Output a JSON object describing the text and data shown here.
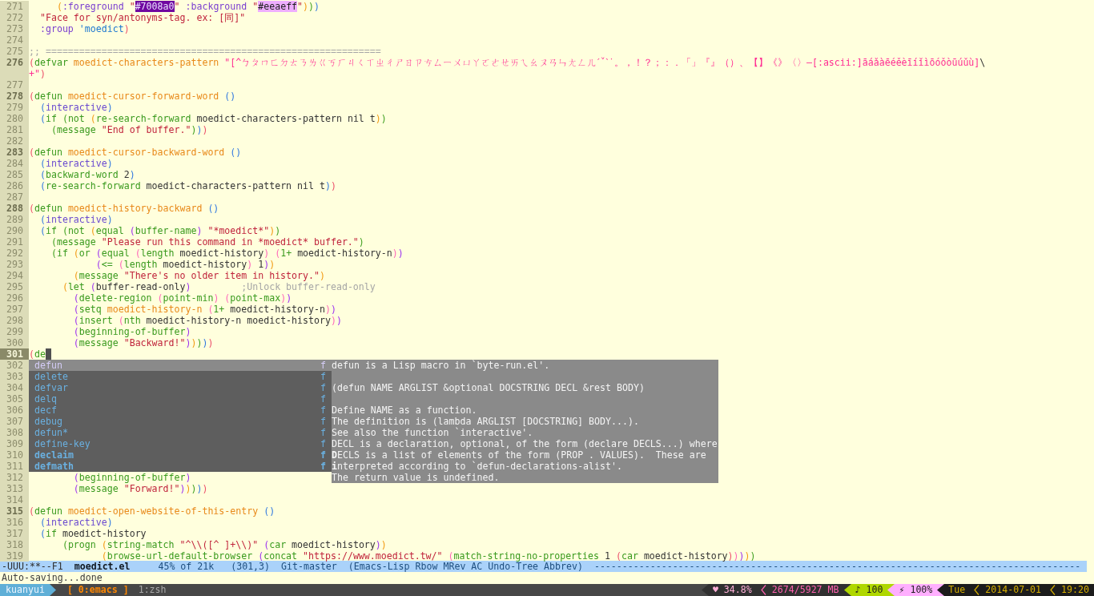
{
  "editor": {
    "lines": [
      {
        "number": "271",
        "bold": false,
        "selected": false,
        "tokens": [
          {
            "text": "     (",
            "kind": "paren4"
          },
          {
            "text": ":foreground",
            "kind": "const"
          },
          {
            "text": " \"",
            "kind": "string"
          },
          {
            "text": "#7008a0",
            "kind": "swatch",
            "color": "#7008a0"
          },
          {
            "text": "\" ",
            "kind": "string"
          },
          {
            "text": ":background",
            "kind": "const"
          },
          {
            "text": " \"",
            "kind": "string"
          },
          {
            "text": "#eeaeff",
            "kind": "swatch",
            "color": "#eeaeff"
          },
          {
            "text": "\"",
            "kind": "string"
          },
          {
            "text": ")",
            "kind": "paren4"
          },
          {
            "text": ")",
            "kind": "paren3"
          },
          {
            "text": ")",
            "kind": "paren2"
          }
        ]
      },
      {
        "number": "272",
        "bold": false,
        "selected": false,
        "tokens": [
          {
            "text": "  \"Face for syn/antonyms-tag. ex: [同]\"",
            "kind": "string"
          }
        ]
      },
      {
        "number": "273",
        "bold": false,
        "selected": false,
        "tokens": [
          {
            "text": "  :group ",
            "kind": "const"
          },
          {
            "text": "'moedict",
            "kind": "quote"
          },
          {
            "text": ")",
            "kind": "paren1"
          }
        ]
      },
      {
        "number": "274",
        "bold": false,
        "selected": false
      },
      {
        "number": "275",
        "bold": false,
        "selected": false,
        "tokens": [
          {
            "text": ";; ============================================================",
            "kind": "comment"
          }
        ]
      },
      {
        "number": "276",
        "bold": true,
        "selected": false,
        "tokens": [
          {
            "text": "(",
            "kind": "paren1"
          },
          {
            "text": "defvar ",
            "kind": "builtin"
          },
          {
            "text": "moedict-characters-pattern ",
            "kind": "name"
          },
          {
            "text": "\"[^ㄅㄆㄇㄈㄉㄊㄋㄌㄍㄎㄏㄐㄑㄒㄓㄔㄕㄖㄗㄘㄙㄧㄨㄩㄚㄛㄜㄝㄞㄟㄠㄡㄢㄣㄤㄥㄦˊˇˋ˙。，！？；：．「」『』（）、【】《》〈〉—[:ascii:]āáǎàēéěèīíǐìōóǒòūúǔù]",
            "kind": "pattern"
          },
          {
            "text": "\\",
            "kind": "wrap"
          }
        ]
      },
      {
        "tokens": [
          {
            "text": "+\"",
            "kind": "pattern"
          },
          {
            "text": ")",
            "kind": "paren1"
          }
        ]
      },
      {
        "number": "277",
        "bold": false,
        "selected": false
      },
      {
        "number": "278",
        "bold": true,
        "selected": false,
        "tokens": [
          {
            "text": "(",
            "kind": "paren1"
          },
          {
            "text": "defun ",
            "kind": "builtin"
          },
          {
            "text": "moedict-cursor-forward-word ",
            "kind": "name"
          },
          {
            "text": "()",
            "kind": "paren2"
          }
        ]
      },
      {
        "number": "279",
        "bold": false,
        "selected": false,
        "tokens": [
          {
            "text": "  (",
            "kind": "paren2"
          },
          {
            "text": "interactive",
            "kind": "special"
          },
          {
            "text": ")",
            "kind": "paren2"
          }
        ]
      },
      {
        "number": "280",
        "bold": false,
        "selected": false,
        "tokens": [
          {
            "text": "  (",
            "kind": "paren2"
          },
          {
            "text": "if ",
            "kind": "builtin"
          },
          {
            "text": "(",
            "kind": "paren3"
          },
          {
            "text": "not ",
            "kind": "builtin"
          },
          {
            "text": "(",
            "kind": "paren4"
          },
          {
            "text": "re-search-forward",
            "kind": "builtin"
          },
          {
            "text": " moedict-characters-pattern nil t",
            "kind": "plain"
          },
          {
            "text": ")",
            "kind": "paren4"
          },
          {
            "text": ")",
            "kind": "paren3"
          }
        ]
      },
      {
        "number": "281",
        "bold": false,
        "selected": false,
        "tokens": [
          {
            "text": "    (",
            "kind": "paren3"
          },
          {
            "text": "message ",
            "kind": "builtin"
          },
          {
            "text": "\"End of buffer.\"",
            "kind": "string"
          },
          {
            "text": ")",
            "kind": "paren3"
          },
          {
            "text": ")",
            "kind": "paren2"
          },
          {
            "text": ")",
            "kind": "paren1"
          }
        ]
      },
      {
        "number": "282",
        "bold": false,
        "selected": false
      },
      {
        "number": "283",
        "bold": true,
        "selected": false,
        "tokens": [
          {
            "text": "(",
            "kind": "paren1"
          },
          {
            "text": "defun ",
            "kind": "builtin"
          },
          {
            "text": "moedict-cursor-backward-word ",
            "kind": "name"
          },
          {
            "text": "()",
            "kind": "paren2"
          }
        ]
      },
      {
        "number": "284",
        "bold": false,
        "selected": false,
        "tokens": [
          {
            "text": "  (",
            "kind": "paren2"
          },
          {
            "text": "interactive",
            "kind": "special"
          },
          {
            "text": ")",
            "kind": "paren2"
          }
        ]
      },
      {
        "number": "285",
        "bold": false,
        "selected": false,
        "tokens": [
          {
            "text": "  (",
            "kind": "paren2"
          },
          {
            "text": "backward-word",
            "kind": "builtin"
          },
          {
            "text": " 2",
            "kind": "plain"
          },
          {
            "text": ")",
            "kind": "paren2"
          }
        ]
      },
      {
        "number": "286",
        "bold": false,
        "selected": false,
        "tokens": [
          {
            "text": "  (",
            "kind": "paren2"
          },
          {
            "text": "re-search-forward",
            "kind": "builtin"
          },
          {
            "text": " moedict-characters-pattern nil t",
            "kind": "plain"
          },
          {
            "text": ")",
            "kind": "paren2"
          },
          {
            "text": ")",
            "kind": "paren1"
          }
        ]
      },
      {
        "number": "287",
        "bold": false,
        "selected": false
      },
      {
        "number": "288",
        "bold": true,
        "selected": false,
        "tokens": [
          {
            "text": "(",
            "kind": "paren1"
          },
          {
            "text": "defun ",
            "kind": "builtin"
          },
          {
            "text": "moedict-history-backward ",
            "kind": "name"
          },
          {
            "text": "()",
            "kind": "paren2"
          }
        ]
      },
      {
        "number": "289",
        "bold": false,
        "selected": false,
        "tokens": [
          {
            "text": "  (",
            "kind": "paren2"
          },
          {
            "text": "interactive",
            "kind": "special"
          },
          {
            "text": ")",
            "kind": "paren2"
          }
        ]
      },
      {
        "number": "290",
        "bold": false,
        "selected": false,
        "tokens": [
          {
            "text": "  (",
            "kind": "paren2"
          },
          {
            "text": "if ",
            "kind": "builtin"
          },
          {
            "text": "(",
            "kind": "paren3"
          },
          {
            "text": "not ",
            "kind": "builtin"
          },
          {
            "text": "(",
            "kind": "paren4"
          },
          {
            "text": "equal ",
            "kind": "builtin"
          },
          {
            "text": "(",
            "kind": "paren5"
          },
          {
            "text": "buffer-name",
            "kind": "builtin"
          },
          {
            "text": ") ",
            "kind": "paren5"
          },
          {
            "text": "\"*moedict*\"",
            "kind": "string"
          },
          {
            "text": ")",
            "kind": "paren4"
          },
          {
            "text": ")",
            "kind": "paren3"
          }
        ]
      },
      {
        "number": "291",
        "bold": false,
        "selected": false,
        "tokens": [
          {
            "text": "    (",
            "kind": "paren3"
          },
          {
            "text": "message ",
            "kind": "builtin"
          },
          {
            "text": "\"Please run this command in *moedict* buffer.\"",
            "kind": "string"
          },
          {
            "text": ")",
            "kind": "paren3"
          }
        ]
      },
      {
        "number": "292",
        "bold": false,
        "selected": false,
        "tokens": [
          {
            "text": "    (",
            "kind": "paren3"
          },
          {
            "text": "if ",
            "kind": "builtin"
          },
          {
            "text": "(",
            "kind": "paren4"
          },
          {
            "text": "or ",
            "kind": "builtin"
          },
          {
            "text": "(",
            "kind": "paren5"
          },
          {
            "text": "equal ",
            "kind": "builtin"
          },
          {
            "text": "(",
            "kind": "paren6"
          },
          {
            "text": "length",
            "kind": "builtin"
          },
          {
            "text": " moedict-history",
            "kind": "plain"
          },
          {
            "text": ") (",
            "kind": "paren6"
          },
          {
            "text": "1+",
            "kind": "builtin"
          },
          {
            "text": " moedict-history-n",
            "kind": "plain"
          },
          {
            "text": ")",
            "kind": "paren6"
          },
          {
            "text": ")",
            "kind": "paren5"
          }
        ]
      },
      {
        "number": "293",
        "bold": false,
        "selected": false,
        "tokens": [
          {
            "text": "            (",
            "kind": "paren5"
          },
          {
            "text": "<= ",
            "kind": "builtin"
          },
          {
            "text": "(",
            "kind": "paren6"
          },
          {
            "text": "length",
            "kind": "builtin"
          },
          {
            "text": " moedict-history",
            "kind": "plain"
          },
          {
            "text": ")",
            "kind": "paren6"
          },
          {
            "text": " 1",
            "kind": "plain"
          },
          {
            "text": ")",
            "kind": "paren5"
          },
          {
            "text": ")",
            "kind": "paren4"
          }
        ]
      },
      {
        "number": "294",
        "bold": false,
        "selected": false,
        "tokens": [
          {
            "text": "        (",
            "kind": "paren4"
          },
          {
            "text": "message ",
            "kind": "builtin"
          },
          {
            "text": "\"There's no older item in history.\"",
            "kind": "string"
          },
          {
            "text": ")",
            "kind": "paren4"
          }
        ]
      },
      {
        "number": "295",
        "bold": false,
        "selected": false,
        "tokens": [
          {
            "text": "      (",
            "kind": "paren4"
          },
          {
            "text": "let ",
            "kind": "builtin"
          },
          {
            "text": "(",
            "kind": "paren5"
          },
          {
            "text": "buffer-read-only",
            "kind": "plain"
          },
          {
            "text": ")",
            "kind": "paren5"
          },
          {
            "text": "         ;Unlock buffer-read-only",
            "kind": "comment"
          }
        ]
      },
      {
        "number": "296",
        "bold": false,
        "selected": false,
        "tokens": [
          {
            "text": "        (",
            "kind": "paren5"
          },
          {
            "text": "delete-region ",
            "kind": "builtin"
          },
          {
            "text": "(",
            "kind": "paren6"
          },
          {
            "text": "point-min",
            "kind": "builtin"
          },
          {
            "text": ") (",
            "kind": "paren6"
          },
          {
            "text": "point-max",
            "kind": "builtin"
          },
          {
            "text": ")",
            "kind": "paren6"
          },
          {
            "text": ")",
            "kind": "paren5"
          }
        ]
      },
      {
        "number": "297",
        "bold": false,
        "selected": false,
        "tokens": [
          {
            "text": "        (",
            "kind": "paren5"
          },
          {
            "text": "setq ",
            "kind": "builtin"
          },
          {
            "text": "moedict-history-n ",
            "kind": "name"
          },
          {
            "text": "(",
            "kind": "paren6"
          },
          {
            "text": "1+",
            "kind": "builtin"
          },
          {
            "text": " moedict-history-n",
            "kind": "plain"
          },
          {
            "text": ")",
            "kind": "paren6"
          },
          {
            "text": ")",
            "kind": "paren5"
          }
        ]
      },
      {
        "number": "298",
        "bold": false,
        "selected": false,
        "tokens": [
          {
            "text": "        (",
            "kind": "paren5"
          },
          {
            "text": "insert ",
            "kind": "builtin"
          },
          {
            "text": "(",
            "kind": "paren6"
          },
          {
            "text": "nth",
            "kind": "builtin"
          },
          {
            "text": " moedict-history-n moedict-history",
            "kind": "plain"
          },
          {
            "text": ")",
            "kind": "paren6"
          },
          {
            "text": ")",
            "kind": "paren5"
          }
        ]
      },
      {
        "number": "299",
        "bold": false,
        "selected": false,
        "tokens": [
          {
            "text": "        (",
            "kind": "paren5"
          },
          {
            "text": "beginning-of-buffer",
            "kind": "builtin"
          },
          {
            "text": ")",
            "kind": "paren5"
          }
        ]
      },
      {
        "number": "300",
        "bold": false,
        "selected": false,
        "tokens": [
          {
            "text": "        (",
            "kind": "paren5"
          },
          {
            "text": "message ",
            "kind": "builtin"
          },
          {
            "text": "\"Backward!\"",
            "kind": "string"
          },
          {
            "text": ")",
            "kind": "paren5"
          },
          {
            "text": ")",
            "kind": "paren4"
          },
          {
            "text": ")",
            "kind": "paren3"
          },
          {
            "text": ")",
            "kind": "paren2"
          },
          {
            "text": ")",
            "kind": "paren1"
          }
        ]
      },
      {
        "number": "301",
        "bold": true,
        "selected": true,
        "cursor": true,
        "tokens": [
          {
            "text": "(",
            "kind": "paren1"
          },
          {
            "text": "de",
            "kind": "builtin"
          }
        ]
      },
      {
        "number": "302",
        "bold": false,
        "selected": false,
        "popup": {
          "candidates": [
            {
              "name": "defun",
              "type": "f",
              "selected": true,
              "bold": false
            },
            {
              "name": "delete",
              "type": "f",
              "selected": false,
              "bold": false
            },
            {
              "name": "defvar",
              "type": "f",
              "selected": false,
              "bold": false
            },
            {
              "name": "delq",
              "type": "f",
              "selected": false,
              "bold": false
            },
            {
              "name": "decf",
              "type": "f",
              "selected": false,
              "bold": false
            },
            {
              "name": "debug",
              "type": "f",
              "selected": false,
              "bold": false
            },
            {
              "name": "defun*",
              "type": "f",
              "selected": false,
              "bold": false
            },
            {
              "name": "define-key",
              "type": "f",
              "selected": false,
              "bold": false
            },
            {
              "name": "declaim",
              "type": "f",
              "selected": false,
              "bold": true
            },
            {
              "name": "defmath",
              "type": "f",
              "selected": false,
              "bold": true
            }
          ],
          "doc": [
            [
              "defun is a Lisp macro in `byte-run.el'."
            ],
            [
              "(defun NAME ARGLIST &optional DOCSTRING DECL &rest BODY)"
            ],
            [
              "Define NAME as a function.",
              "The definition is (lambda ARGLIST [DOCSTRING] BODY...).",
              "See also the function `interactive'.",
              "DECL is a declaration, optional, of the form (declare DECLS...) where",
              "**D**ECLS is a list of elements of the form (PROP . VALUES).  These are",
              "**i**nterpreted according to `defun-declarations-alist'.",
              "The return value is undefined."
            ]
          ]
        }
      },
      {
        "number": "303",
        "bold": false,
        "selected": false
      },
      {
        "number": "304",
        "bold": false,
        "selected": false
      },
      {
        "number": "305",
        "bold": false,
        "selected": false
      },
      {
        "number": "306",
        "bold": false,
        "selected": false
      },
      {
        "number": "307",
        "bold": false,
        "selected": false
      },
      {
        "number": "308",
        "bold": false,
        "selected": false
      },
      {
        "number": "309",
        "bold": false,
        "selected": false
      },
      {
        "number": "310",
        "bold": false,
        "selected": false
      },
      {
        "number": "311",
        "bold": false,
        "selected": false
      },
      {
        "number": "312",
        "bold": false,
        "selected": false,
        "tokens": [
          {
            "text": "        (",
            "kind": "paren5"
          },
          {
            "text": "beginning-of-buffer",
            "kind": "builtin"
          },
          {
            "text": ")",
            "kind": "paren5"
          }
        ]
      },
      {
        "number": "313",
        "bold": false,
        "selected": false,
        "tokens": [
          {
            "text": "        (",
            "kind": "paren5"
          },
          {
            "text": "message ",
            "kind": "builtin"
          },
          {
            "text": "\"Forward!\"",
            "kind": "string"
          },
          {
            "text": ")",
            "kind": "paren5"
          },
          {
            "text": ")",
            "kind": "paren4"
          },
          {
            "text": ")",
            "kind": "paren3"
          },
          {
            "text": ")",
            "kind": "paren2"
          },
          {
            "text": ")",
            "kind": "paren1"
          }
        ]
      },
      {
        "number": "314",
        "bold": false,
        "selected": false
      },
      {
        "number": "315",
        "bold": true,
        "selected": false,
        "tokens": [
          {
            "text": "(",
            "kind": "paren1"
          },
          {
            "text": "defun ",
            "kind": "builtin"
          },
          {
            "text": "moedict-open-website-of-this-entry ",
            "kind": "name"
          },
          {
            "text": "()",
            "kind": "paren2"
          }
        ]
      },
      {
        "number": "316",
        "bold": false,
        "selected": false,
        "tokens": [
          {
            "text": "  (",
            "kind": "paren2"
          },
          {
            "text": "interactive",
            "kind": "special"
          },
          {
            "text": ")",
            "kind": "paren2"
          }
        ]
      },
      {
        "number": "317",
        "bold": false,
        "selected": false,
        "tokens": [
          {
            "text": "  (",
            "kind": "paren2"
          },
          {
            "text": "if",
            "kind": "builtin"
          },
          {
            "text": " moedict-history",
            "kind": "plain"
          }
        ]
      },
      {
        "number": "318",
        "bold": false,
        "selected": false,
        "tokens": [
          {
            "text": "      (",
            "kind": "paren3"
          },
          {
            "text": "progn ",
            "kind": "builtin"
          },
          {
            "text": "(",
            "kind": "paren4"
          },
          {
            "text": "string-match ",
            "kind": "builtin"
          },
          {
            "text": "\"^\\\\([^ ]+\\\\)\" ",
            "kind": "string"
          },
          {
            "text": "(",
            "kind": "paren5"
          },
          {
            "text": "car",
            "kind": "builtin"
          },
          {
            "text": " moedict-history",
            "kind": "plain"
          },
          {
            "text": ")",
            "kind": "paren5"
          },
          {
            "text": ")",
            "kind": "paren4"
          }
        ]
      },
      {
        "number": "319",
        "bold": false,
        "selected": false,
        "tokens": [
          {
            "text": "             (",
            "kind": "paren4"
          },
          {
            "text": "browse-url-default-browser ",
            "kind": "builtin"
          },
          {
            "text": "(",
            "kind": "paren5"
          },
          {
            "text": "concat ",
            "kind": "builtin"
          },
          {
            "text": "\"https://www.moedict.tw/\" ",
            "kind": "string"
          },
          {
            "text": "(",
            "kind": "paren6"
          },
          {
            "text": "match-string-no-properties",
            "kind": "builtin"
          },
          {
            "text": " 1 ",
            "kind": "plain"
          },
          {
            "text": "(",
            "kind": "paren1"
          },
          {
            "text": "car",
            "kind": "builtin"
          },
          {
            "text": " moedict-history",
            "kind": "plain"
          },
          {
            "text": ")",
            "kind": "paren1"
          },
          {
            "text": ")",
            "kind": "paren6"
          },
          {
            "text": ")",
            "kind": "paren5"
          },
          {
            "text": ")",
            "kind": "paren4"
          },
          {
            "text": ")",
            "kind": "paren3"
          }
        ]
      }
    ]
  },
  "mode_line": [
    {
      "text": "-UUU:**--F1",
      "kind": "status"
    },
    {
      "text": "moedict.el",
      "kind": "buffer"
    },
    {
      "text": "45% of 21k",
      "kind": "plain"
    },
    {
      "text": "(301,3)",
      "kind": "plain"
    },
    {
      "text": "Git-master",
      "kind": "plain"
    },
    {
      "text": "(Emacs-Lisp Rbow MRev AC Undo-Tree Abbrev)",
      "kind": "plain"
    },
    {
      "text": "---------------------------------------------------------------------------------------",
      "kind": "fill"
    }
  ],
  "echo_area": "Auto-saving...done",
  "tmux": {
    "session": "kuanyui",
    "windows": [
      {
        "text": "[ 0:emacs ]",
        "selected": true
      },
      {
        "text": "1:zsh",
        "selected": false
      }
    ],
    "status": [
      {
        "text": "♥ 34.8%",
        "kind": "dark",
        "color": "#ffafd7"
      },
      {
        "text": "2674/5927 MB",
        "kind": "dark",
        "color": "#ff5faf"
      },
      {
        "text": "♪ 100",
        "kind": "filled",
        "color": "#afd700"
      },
      {
        "text": "⚡ 100%",
        "kind": "filled",
        "color": "#ffafff"
      },
      {
        "text": "Tue",
        "kind": "black",
        "color": "#d7af00"
      },
      {
        "text": "2014-07-01",
        "kind": "black",
        "color": "#d7af00"
      },
      {
        "text": "19:20",
        "kind": "black",
        "color": "#d7af00"
      }
    ]
  }
}
